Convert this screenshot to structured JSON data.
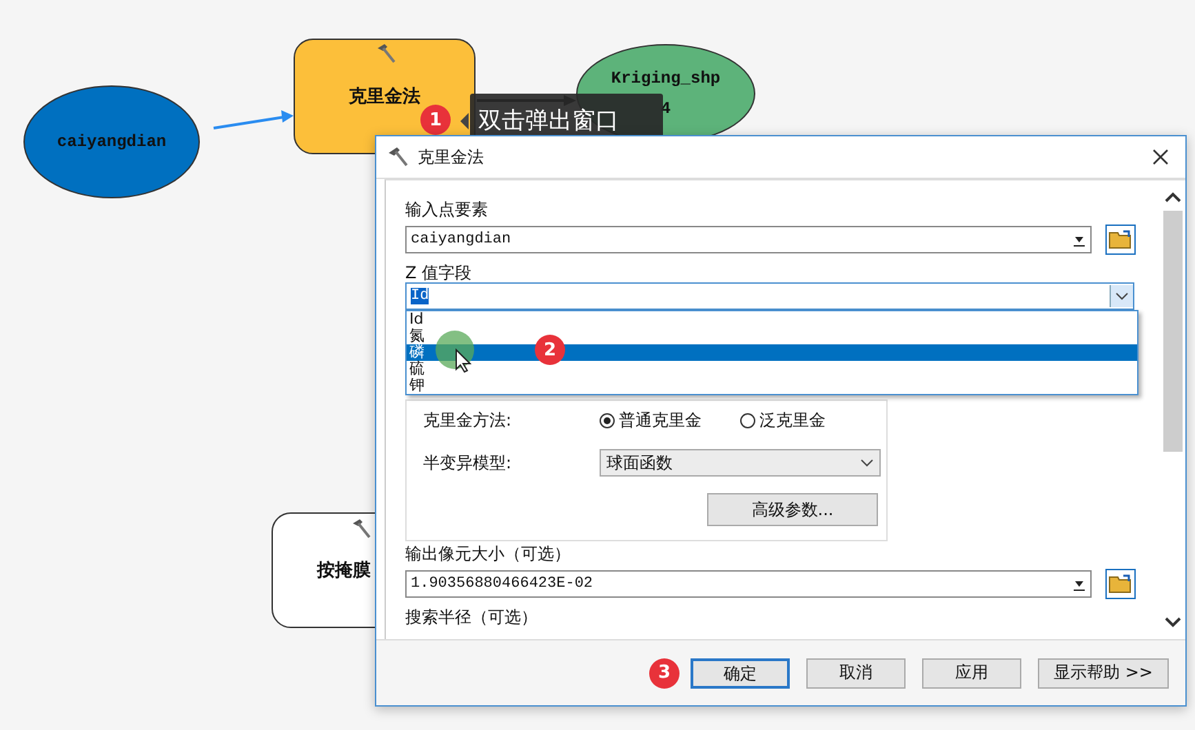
{
  "canvas": {
    "nodes": [
      {
        "kind": "data",
        "label": "caiyangdian",
        "color": "#0070c0"
      },
      {
        "kind": "tool",
        "label": "克里金法",
        "color": "#fcbf3a"
      },
      {
        "kind": "output",
        "label": "Kriging_shp",
        "label_2": "4",
        "color": "#5db37a"
      },
      {
        "kind": "tool",
        "label": "按掩膜",
        "color": "#ffffff"
      }
    ]
  },
  "tooltip": {
    "badge": "1",
    "text": "双击弹出窗口"
  },
  "dialog": {
    "title": "克里金法",
    "input_label": "输入点要素",
    "input_value": "caiyangdian",
    "z_label": "Z 值字段",
    "z_value": "Id",
    "z_options": [
      {
        "label": "Id",
        "selected": false
      },
      {
        "label": "氮",
        "selected": false
      },
      {
        "label": "磷",
        "selected": true
      },
      {
        "label": "硫",
        "selected": false
      },
      {
        "label": "钾",
        "selected": false
      }
    ],
    "dropdown_badge": "2",
    "method_label": "克里金方法:",
    "methods": [
      {
        "label": "普通克里金",
        "selected": true
      },
      {
        "label": "泛克里金",
        "selected": false
      }
    ],
    "model_label": "半变异模型:",
    "model_value": "球面函数",
    "advanced_button": "高级参数...",
    "cell_label": "输出像元大小（可选）",
    "cell_value": "1.90356880466423E-02",
    "radius_label": "搜索半径（可选）",
    "footer_badge": "3",
    "buttons": [
      {
        "label": "确定",
        "default": true
      },
      {
        "label": "取消",
        "default": false
      },
      {
        "label": "应用",
        "default": false
      },
      {
        "label": "显示帮助 >>",
        "default": false
      }
    ]
  }
}
